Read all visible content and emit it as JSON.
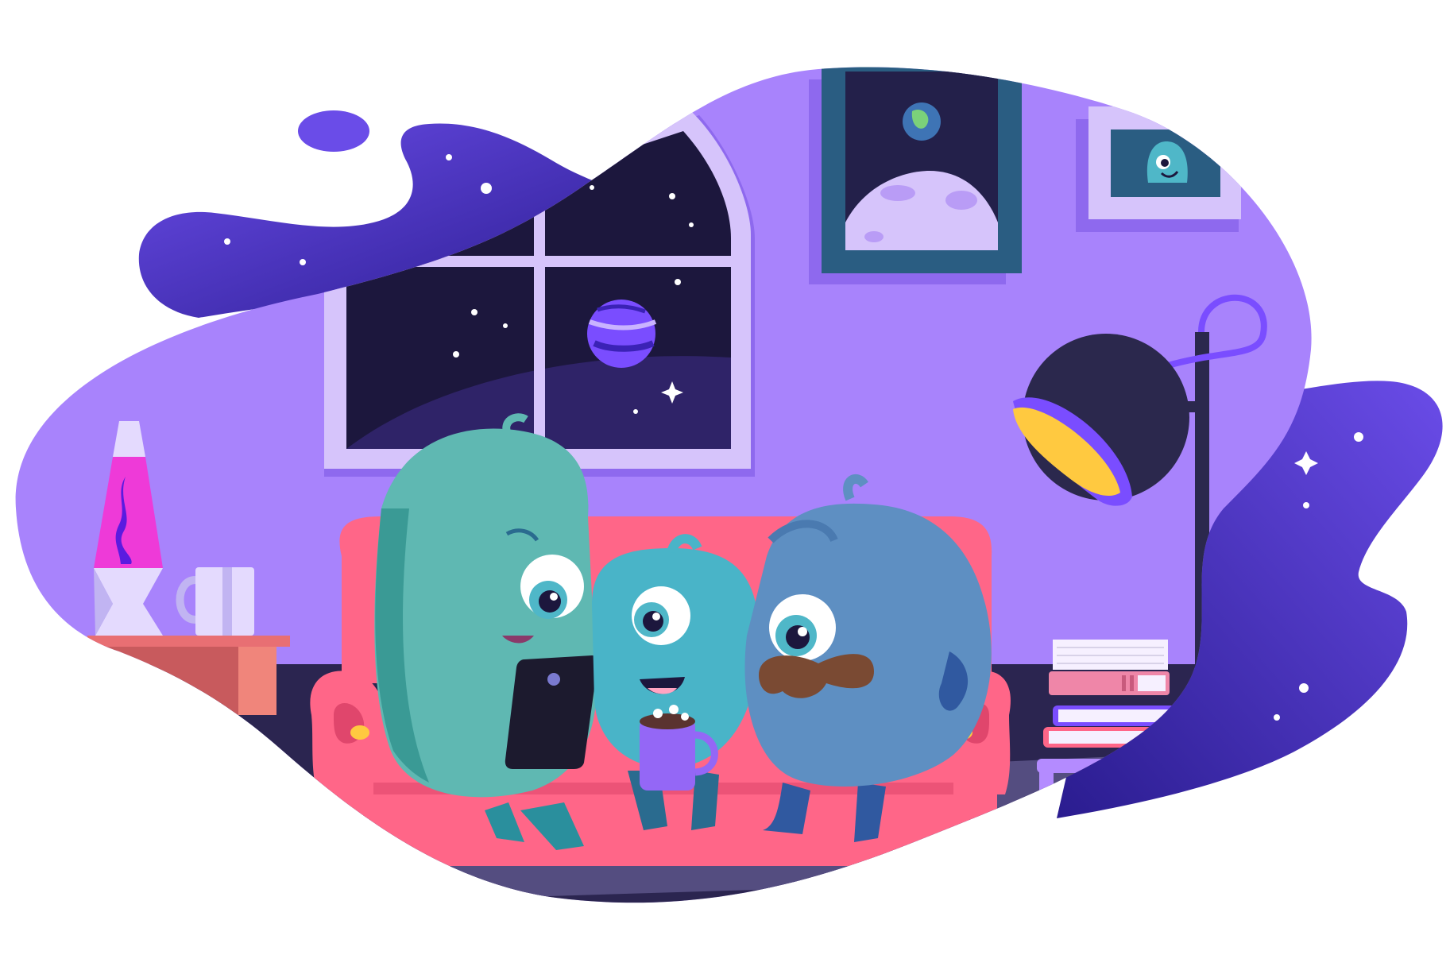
{
  "scene": {
    "alt": "",
    "palette": {
      "background": "#ffffff",
      "wall": "#a883fc",
      "wall_shadow": "#8e69ee",
      "floor": "#2b2550",
      "floor_lit": "#544d80",
      "space_dark": "#2a1f7a",
      "space_light": "#5b3fe0",
      "window_frame": "#d6c4fb",
      "window_night": "#1c173d",
      "sofa": "#ff6688",
      "sofa_shadow": "#e0466c",
      "teal_monster": "#5fb8b2",
      "cyan_monster": "#49b4c8",
      "blue_monster": "#5e8fc2",
      "lamp_dark": "#2b284d",
      "lamp_light": "#ffc940",
      "lava_pink": "#ee3ad8",
      "accent_purple": "#7a4dff"
    }
  }
}
